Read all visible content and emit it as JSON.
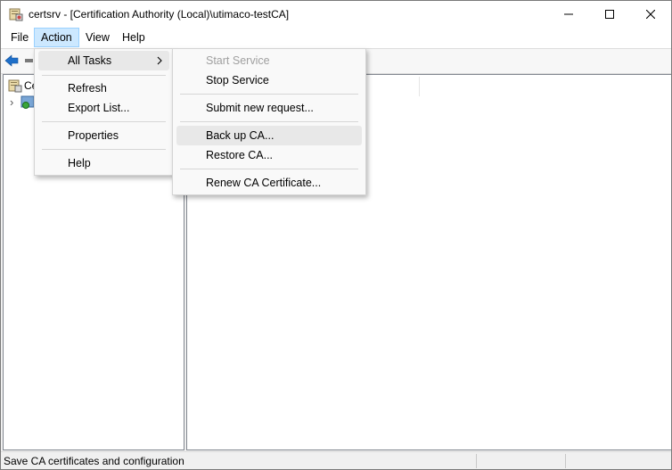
{
  "window": {
    "title": "certsrv - [Certification Authority (Local)\\utimaco-testCA]"
  },
  "menubar": {
    "file": "File",
    "action": "Action",
    "view": "View",
    "help": "Help"
  },
  "tree": {
    "root_label": "Ce",
    "child_expander": "›"
  },
  "action_menu": {
    "all_tasks": "All Tasks",
    "refresh": "Refresh",
    "export_list": "Export List...",
    "properties": "Properties",
    "help": "Help"
  },
  "tasks_menu": {
    "start_service": "Start Service",
    "stop_service": "Stop Service",
    "submit_request": "Submit new request...",
    "backup_ca": "Back up CA...",
    "restore_ca": "Restore CA...",
    "renew_cert": "Renew CA Certificate..."
  },
  "status": {
    "text": "Save CA certificates and configuration"
  },
  "colors": {
    "accent": "#1e6fc9",
    "menu_highlight": "#e8e8e8",
    "menubar_active": "#cce8ff"
  }
}
